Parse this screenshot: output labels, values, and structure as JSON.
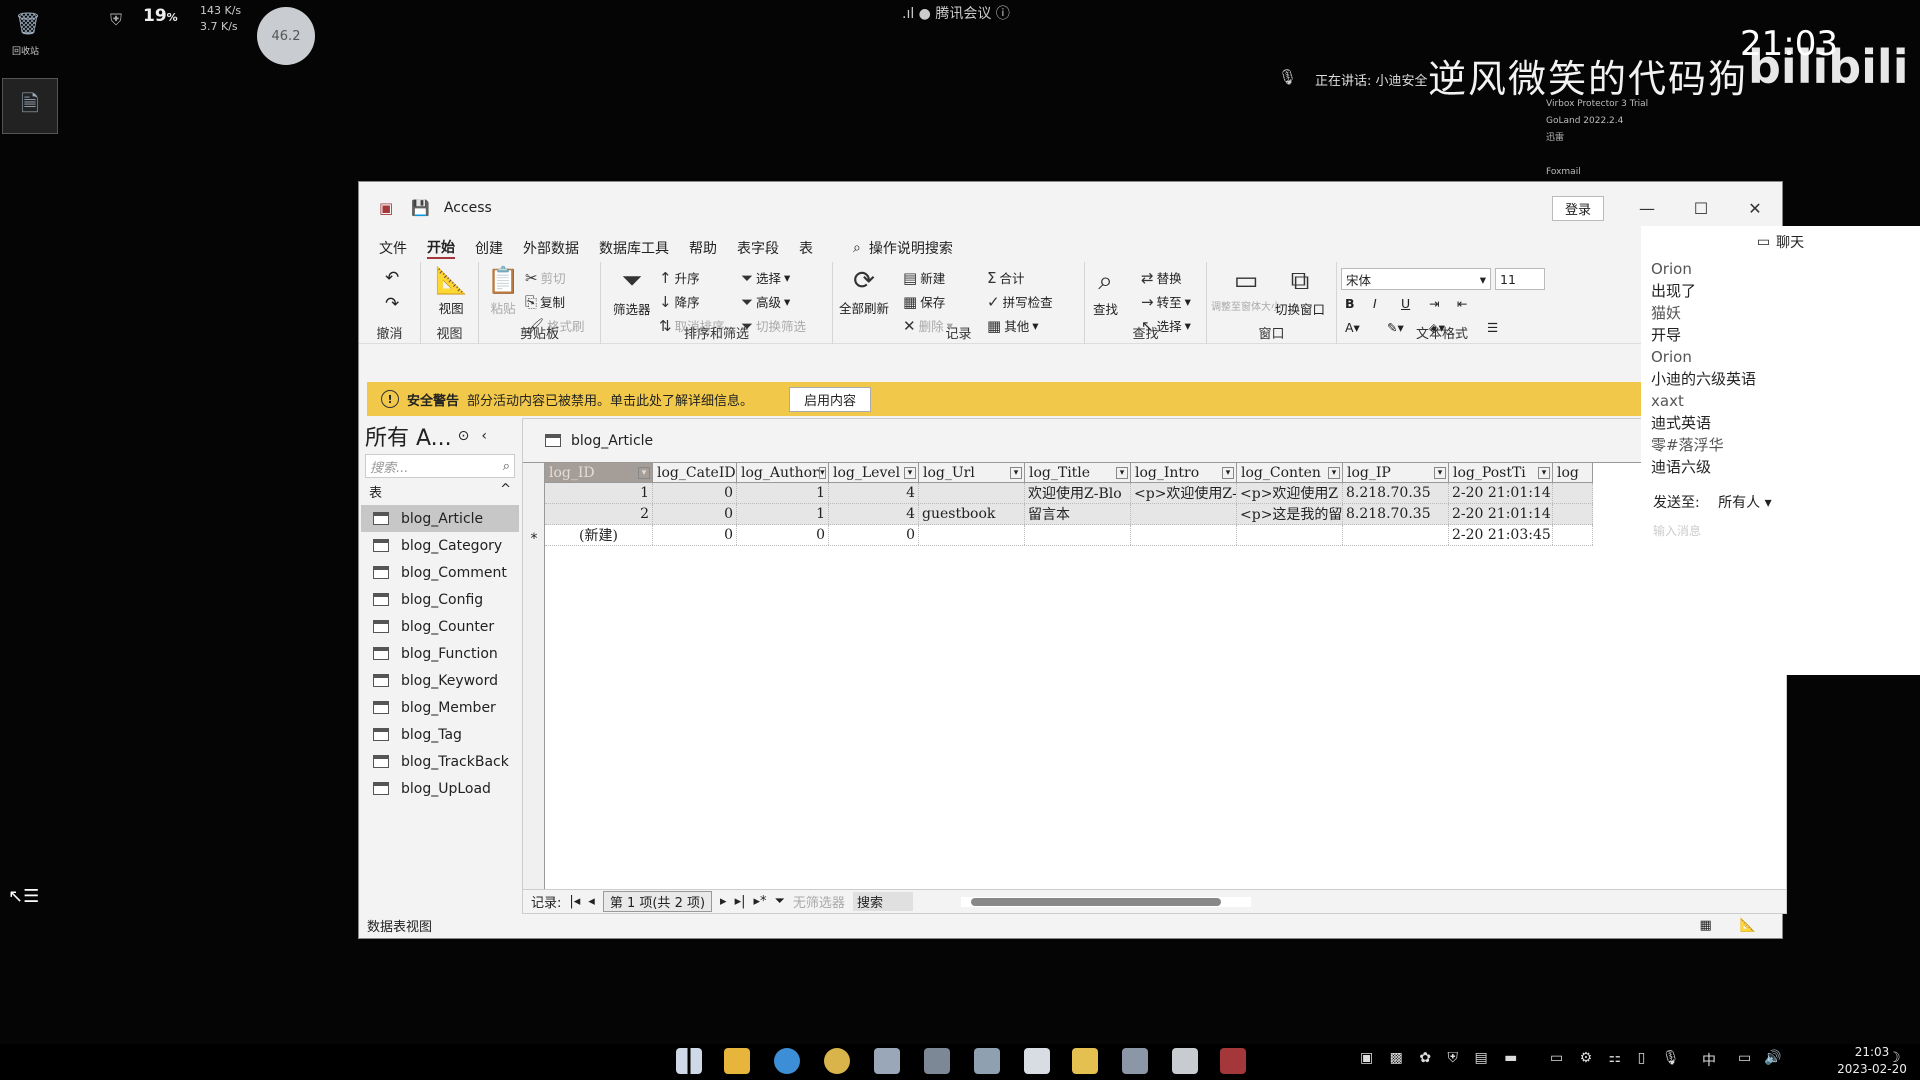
{
  "desktop": {
    "recycle_label": "回收站",
    "cpu_percent": "19",
    "net_up": "143 K/s",
    "net_down": "3.7 K/s",
    "badge": "46.2",
    "meeting_title": "腾讯会议",
    "speaking": "正在讲话: 小迪安全",
    "overlay_title": "逆风微笑的代码狗",
    "bilibili": "bilibili",
    "clock": "21:03"
  },
  "right_panel": {
    "items": [
      "Virbox Protector 3 Trial",
      "GoLand 2022.2.4",
      "迅雷",
      "Foxmail"
    ]
  },
  "window": {
    "app_title": "Access",
    "login_label": "登录",
    "menu": [
      "文件",
      "开始",
      "创建",
      "外部数据",
      "数据库工具",
      "帮助",
      "表字段",
      "表"
    ],
    "active_menu": "开始",
    "tell_me": "操作说明搜索",
    "ribbon": {
      "undo_group": "撤消",
      "view_group": "视图",
      "view_btn": "视图",
      "clipboard_group": "剪贴板",
      "paste": "粘贴",
      "cut": "剪切",
      "copy": "复制",
      "format_painter": "格式刷",
      "sort_group": "排序和筛选",
      "filter": "筛选器",
      "asc": "升序",
      "desc": "降序",
      "remove_sort": "取消排序",
      "selection": "选择",
      "advanced": "高级",
      "toggle_filter": "切换筛选",
      "records_group": "记录",
      "refresh_all": "全部刷新",
      "new": "新建",
      "save": "保存",
      "delete": "删除",
      "totals": "合计",
      "spelling": "拼写检查",
      "more": "其他",
      "find_group": "查找",
      "find": "查找",
      "replace": "替换",
      "goto": "转至",
      "select": "选择",
      "window_group": "窗口",
      "fit_window": "调整至窗体大小",
      "switch_window": "切换窗口",
      "text_group": "文本格式",
      "font": "宋体",
      "font_size": "11"
    },
    "security": {
      "title": "安全警告",
      "message": "部分活动内容已被禁用。单击此处了解详细信息。",
      "button": "启用内容"
    },
    "nav": {
      "title": "所有 A...",
      "search_placeholder": "搜索...",
      "section": "表",
      "tables": [
        "blog_Article",
        "blog_Category",
        "blog_Comment",
        "blog_Config",
        "blog_Counter",
        "blog_Function",
        "blog_Keyword",
        "blog_Member",
        "blog_Tag",
        "blog_TrackBack",
        "blog_UpLoad"
      ],
      "selected": "blog_Article"
    },
    "sheet": {
      "tab": "blog_Article",
      "columns": [
        "log_ID",
        "log_CateID",
        "log_Author",
        "log_Level",
        "log_Url",
        "log_Title",
        "log_Intro",
        "log_Conten",
        "log_IP",
        "log_PostTi",
        "log"
      ],
      "rows": [
        [
          "1",
          "0",
          "1",
          "4",
          "",
          "欢迎使用Z-Blo",
          "<p>欢迎使用Z-",
          "<p>欢迎使用Z",
          "8.218.70.35",
          "2-20 21:01:14",
          ""
        ],
        [
          "2",
          "0",
          "1",
          "4",
          "guestbook",
          "留言本",
          "",
          "<p>这是我的留",
          "8.218.70.35",
          "2-20 21:01:14",
          ""
        ],
        [
          "(新建)",
          "0",
          "0",
          "0",
          "",
          "",
          "",
          "",
          "",
          "2-20 21:03:45",
          ""
        ]
      ],
      "record_label": "记录:",
      "record_pos": "第 1 项(共 2 项)",
      "no_filter": "无筛选器",
      "search": "搜索"
    },
    "status": "数据表视图"
  },
  "chat": {
    "title": "聊天",
    "messages": [
      {
        "who": "Orion",
        "text": "出现了"
      },
      {
        "who": "猫妖",
        "text": "开导"
      },
      {
        "who": "Orion",
        "text": "小迪的六级英语"
      },
      {
        "who": "xaxt",
        "text": "迪式英语"
      },
      {
        "who": "零#落浮华",
        "text": "迪语六级"
      }
    ],
    "send_to_label": "发送至:",
    "send_to_value": "所有人",
    "input_placeholder": "输入消息"
  },
  "taskbar": {
    "time": "21:03",
    "date": "2023-02-20",
    "ime": "中"
  }
}
